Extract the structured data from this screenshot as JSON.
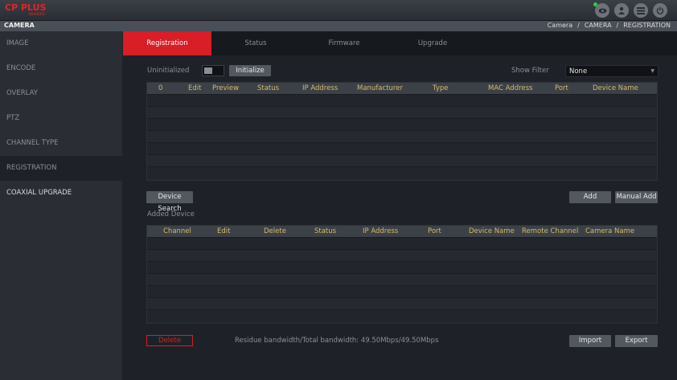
{
  "app": {
    "brand": "CP PLUS",
    "brand_sub": "BRANDED"
  },
  "top_icons": [
    "eye-icon",
    "user-icon",
    "menu-icon",
    "power-icon"
  ],
  "titlebar": {
    "title": "CAMERA",
    "breadcrumb": [
      "Camera",
      "/",
      "CAMERA",
      "/",
      "REGISTRATION"
    ]
  },
  "sidebar": {
    "items": [
      {
        "label": "IMAGE"
      },
      {
        "label": "ENCODE"
      },
      {
        "label": "OVERLAY"
      },
      {
        "label": "PTZ"
      },
      {
        "label": "CHANNEL TYPE"
      },
      {
        "label": "REGISTRATION"
      },
      {
        "label": "COAXIAL UPGRADE"
      }
    ],
    "active_index": 5
  },
  "tabs": [
    {
      "label": "Registration"
    },
    {
      "label": "Status"
    },
    {
      "label": "Firmware"
    },
    {
      "label": "Upgrade"
    }
  ],
  "filter_row": {
    "uninitialized_label": "Uninitialized",
    "initialize_label": "Initialize",
    "show_filter_label": "Show Filter",
    "show_filter_value": "None"
  },
  "search_table": {
    "columns": [
      "0",
      "Edit",
      "Preview",
      "Status",
      "IP Address",
      "Manufacturer",
      "Type",
      "MAC Address",
      "Port",
      "Device Name"
    ],
    "rows": 7
  },
  "actions": {
    "device_search_label": "Device Search",
    "add_label": "Add",
    "manual_add_label": "Manual Add",
    "added_device_label": "Added Device"
  },
  "added_table": {
    "columns": [
      "Channel",
      "Edit",
      "Delete",
      "Status",
      "IP Address",
      "Port",
      "Device Name",
      "Remote Channel",
      "Camera Name"
    ],
    "rows": 7
  },
  "footer": {
    "delete_label": "Delete",
    "bandwidth_text": "Residue bandwidth/Total bandwidth: 49.50Mbps/49.50Mbps",
    "import_label": "Import",
    "export_label": "Export"
  }
}
